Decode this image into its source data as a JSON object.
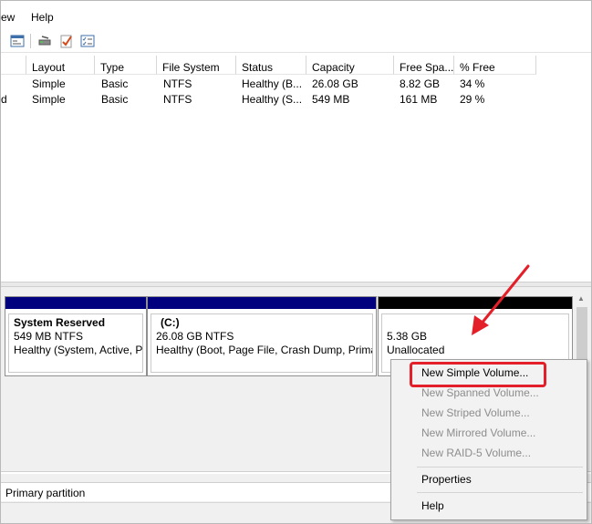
{
  "menu": {
    "view_label": "ew",
    "help_label": "Help"
  },
  "toolbar": {
    "icons": [
      "properties-icon",
      "rescan-icon",
      "check-icon",
      "list-icon"
    ]
  },
  "volume_list": {
    "columns": [
      "Layout",
      "Type",
      "File System",
      "Status",
      "Capacity",
      "Free Spa...",
      "% Free"
    ],
    "rows": [
      {
        "prefix": "",
        "layout": "Simple",
        "type": "Basic",
        "fs": "NTFS",
        "status": "Healthy (B...",
        "capacity": "26.08 GB",
        "free": "8.82 GB",
        "pct": "34 %"
      },
      {
        "prefix": "d",
        "layout": "Simple",
        "type": "Basic",
        "fs": "NTFS",
        "status": "Healthy (S...",
        "capacity": "549 MB",
        "free": "161 MB",
        "pct": "29 %"
      }
    ]
  },
  "disk": {
    "partitions": [
      {
        "title": "System Reserved",
        "size": "549 MB NTFS",
        "status": "Healthy (System, Active, Pr"
      },
      {
        "title": "(C:)",
        "size": "26.08 GB NTFS",
        "status": "Healthy (Boot, Page File, Crash Dump, Primar"
      },
      {
        "size": "5.38 GB",
        "status": "Unallocated"
      }
    ],
    "colors": {
      "primary_bar": "#00007f",
      "unallocated_bar": "#000000"
    }
  },
  "legend": {
    "primary_label": "Primary partition"
  },
  "context_menu": {
    "items": [
      {
        "label": "New Simple Volume...",
        "enabled": true
      },
      {
        "label": "New Spanned Volume...",
        "enabled": false
      },
      {
        "label": "New Striped Volume...",
        "enabled": false
      },
      {
        "label": "New Mirrored Volume...",
        "enabled": false
      },
      {
        "label": "New RAID-5 Volume...",
        "enabled": false
      },
      {
        "label": "Properties",
        "enabled": true
      },
      {
        "label": "Help",
        "enabled": true
      }
    ]
  },
  "annotation": {
    "highlight_color": "#e3202a"
  }
}
